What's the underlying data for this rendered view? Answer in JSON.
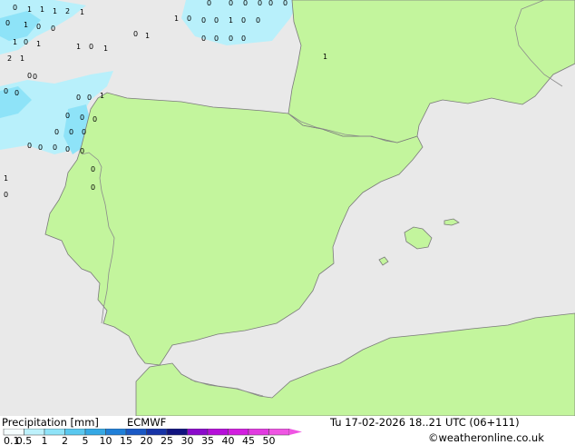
{
  "legend": {
    "title": "Precipitation [mm]",
    "model": "ECMWF",
    "ticks": [
      "0.1",
      "0.5",
      "1",
      "2",
      "5",
      "10",
      "15",
      "20",
      "25",
      "30",
      "35",
      "40",
      "45",
      "50"
    ],
    "colors": [
      "#f5fdfe",
      "#bdf1fb",
      "#8fe3f8",
      "#5ac8ef",
      "#35a8e4",
      "#1f7fd8",
      "#1a58c4",
      "#1633a6",
      "#10137f",
      "#8a0acb",
      "#b50fd9",
      "#d21edf",
      "#e13ae0",
      "#ef55e3"
    ]
  },
  "valid_time": "Tu 17-02-2026 18..21 UTC (06+111)",
  "credit": "©weatheronline.co.uk",
  "map_colors": {
    "land": "#c3f59d",
    "sea": "#e9e9e9",
    "border": "#8b8b8b",
    "coast": "#7a7a7a",
    "precip_light": "#b8f0fb",
    "precip_mid": "#8ee3f8"
  },
  "station_values": [
    "0",
    "1",
    "1",
    "1",
    "2",
    "1",
    "0",
    "1",
    "0",
    "0",
    "1",
    "0",
    "1",
    "1",
    "0",
    "1",
    "2",
    "1",
    "0",
    "0",
    "0",
    "0",
    "0",
    "0",
    "1",
    "0",
    "0",
    "0",
    "0",
    "0",
    "0",
    "0",
    "0",
    "0",
    "0",
    "0",
    "0",
    "0",
    "1",
    "0",
    "0",
    "1",
    "1",
    "0",
    "0",
    "0",
    "1",
    "0",
    "0",
    "0",
    "0",
    "0",
    "0",
    "1",
    "0",
    "0",
    "0",
    "0",
    "0",
    "0"
  ]
}
